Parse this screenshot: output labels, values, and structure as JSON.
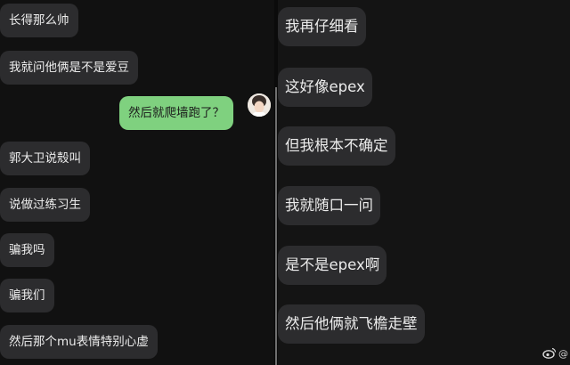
{
  "left_chat": {
    "messages": [
      {
        "text": "长得那么帅"
      },
      {
        "text": "我就问他俩是不是爱豆"
      },
      {
        "text": "然后就爬墙跑了？"
      },
      {
        "text": "郭大卫说殼叫"
      },
      {
        "text": "说做过练习生"
      },
      {
        "text": "骗我吗"
      },
      {
        "text": "骗我们"
      },
      {
        "text": "然后那个mu表情特别心虚"
      }
    ],
    "sent_bubble_color": "#7fd17f",
    "received_bubble_color": "#2c2c2e"
  },
  "right_chat": {
    "messages": [
      {
        "text": "我再仔细看"
      },
      {
        "text": "这好像epex"
      },
      {
        "text": "但我根本不确定"
      },
      {
        "text": "我就随口一问"
      },
      {
        "text": "是不是epex啊"
      },
      {
        "text": "然后他俩就飞檐走壁"
      }
    ]
  },
  "watermark": {
    "text": "@"
  },
  "icons": {
    "avatar": "user-avatar",
    "watermark_logo": "weibo-logo-icon"
  }
}
